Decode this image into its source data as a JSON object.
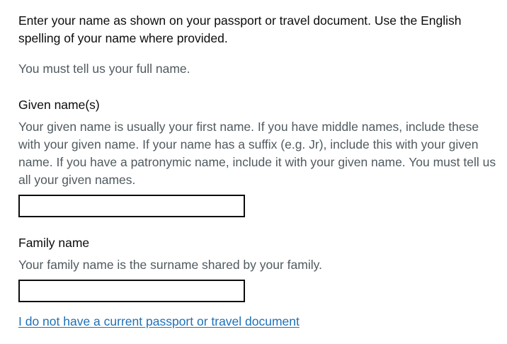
{
  "intro": "Enter your name as shown on your passport or travel document. Use the English spelling of your name where provided.",
  "full_name_hint": "You must tell us your full name.",
  "given": {
    "label": "Given name(s)",
    "hint": "Your given name is usually your first name. If you have middle names, include these with your given name. If your name has a suffix (e.g. Jr), include this with your given name. If you have a patronymic name, include it with your given name. You must tell us all your given names.",
    "value": ""
  },
  "family": {
    "label": "Family name",
    "hint": "Your family name is the surname shared by your family.",
    "value": ""
  },
  "no_passport_link": "I do not have a current passport or travel document",
  "colors": {
    "text": "#0b0c0c",
    "hint": "#505a5f",
    "link": "#1d70b8"
  }
}
